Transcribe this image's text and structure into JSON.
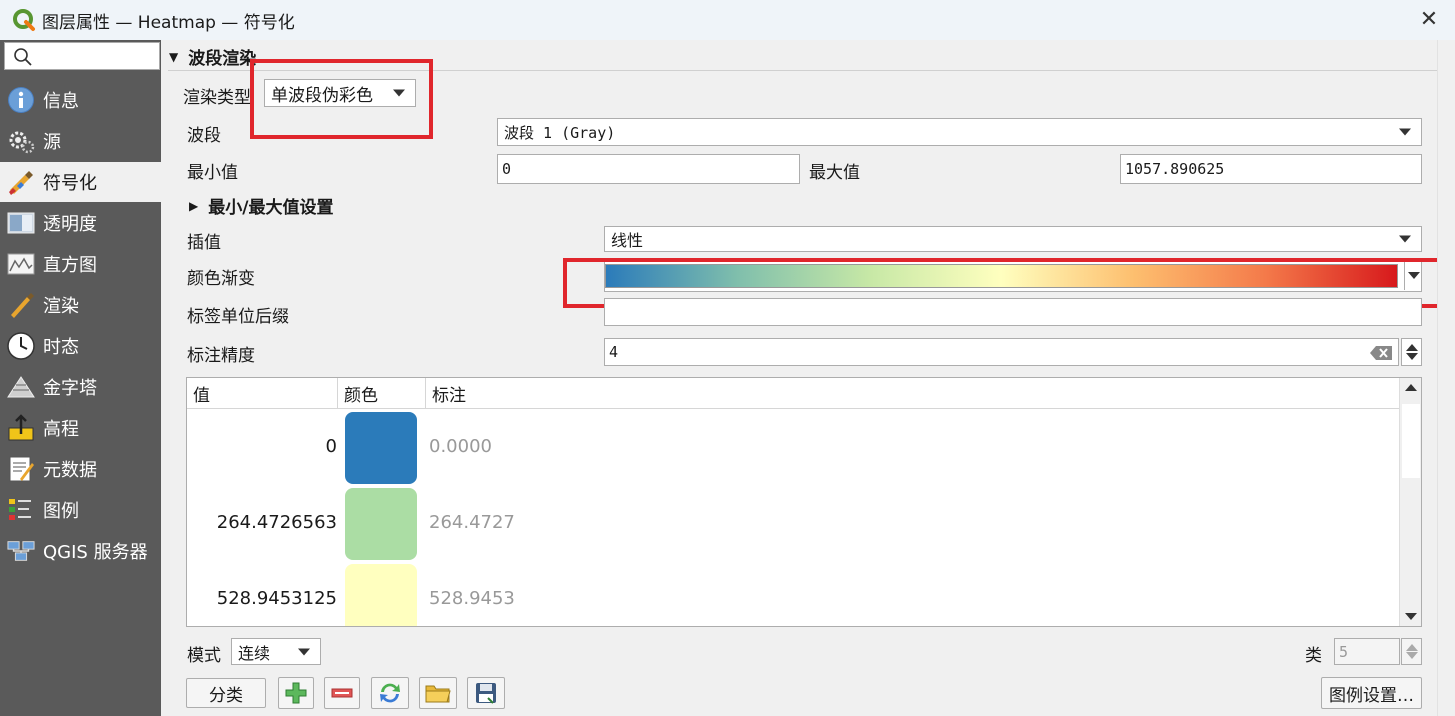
{
  "window": {
    "title": "图层属性 — Heatmap — 符号化",
    "close_glyph": "✕"
  },
  "sidebar": {
    "search_placeholder": "",
    "items": [
      {
        "label": "信息",
        "icon": "info-icon"
      },
      {
        "label": "源",
        "icon": "source-icon"
      },
      {
        "label": "符号化",
        "icon": "symbology-icon",
        "selected": true
      },
      {
        "label": "透明度",
        "icon": "transparency-icon"
      },
      {
        "label": "直方图",
        "icon": "histogram-icon"
      },
      {
        "label": "渲染",
        "icon": "rendering-icon"
      },
      {
        "label": "时态",
        "icon": "temporal-icon"
      },
      {
        "label": "金字塔",
        "icon": "pyramids-icon"
      },
      {
        "label": "高程",
        "icon": "elevation-icon"
      },
      {
        "label": "元数据",
        "icon": "metadata-icon"
      },
      {
        "label": "图例",
        "icon": "legend-icon"
      },
      {
        "label": "QGIS 服务器",
        "icon": "qgis-server-icon"
      }
    ]
  },
  "band_render": {
    "section_title": "波段渲染",
    "render_type_label": "渲染类型",
    "render_type_value": "单波段伪彩色",
    "band_label": "波段",
    "band_value": "波段 1 (Gray)",
    "min_label": "最小值",
    "min_value": "0",
    "max_label": "最大值",
    "max_value": "1057.890625",
    "minmax_settings_label": "最小/最大值设置",
    "interpolation_label": "插值",
    "interpolation_value": "线性",
    "color_ramp_label": "颜色渐变",
    "color_ramp_stops": [
      "#2b7bba",
      "#80bfac",
      "#c7e8a6",
      "#ffffbf",
      "#fdbf6f",
      "#f47a4a",
      "#d7191c"
    ],
    "label_suffix_label": "标签单位后缀",
    "label_suffix_value": "",
    "label_precision_label": "标注精度",
    "label_precision_value": "4"
  },
  "table": {
    "headers": [
      "值",
      "颜色",
      "标注"
    ],
    "rows": [
      {
        "value": "0",
        "color": "#2b7bba",
        "label": "0.0000"
      },
      {
        "value": "264.4726563",
        "color": "#abdda4",
        "label": "264.4727"
      },
      {
        "value": "528.9453125",
        "color": "#ffffbf",
        "label": "528.9453"
      }
    ]
  },
  "footer": {
    "mode_label": "模式",
    "mode_value": "连续",
    "classes_label": "类",
    "classes_value": "5",
    "classify_button": "分类",
    "legend_settings_button": "图例设置…"
  },
  "highlight_color": "#e0262c"
}
